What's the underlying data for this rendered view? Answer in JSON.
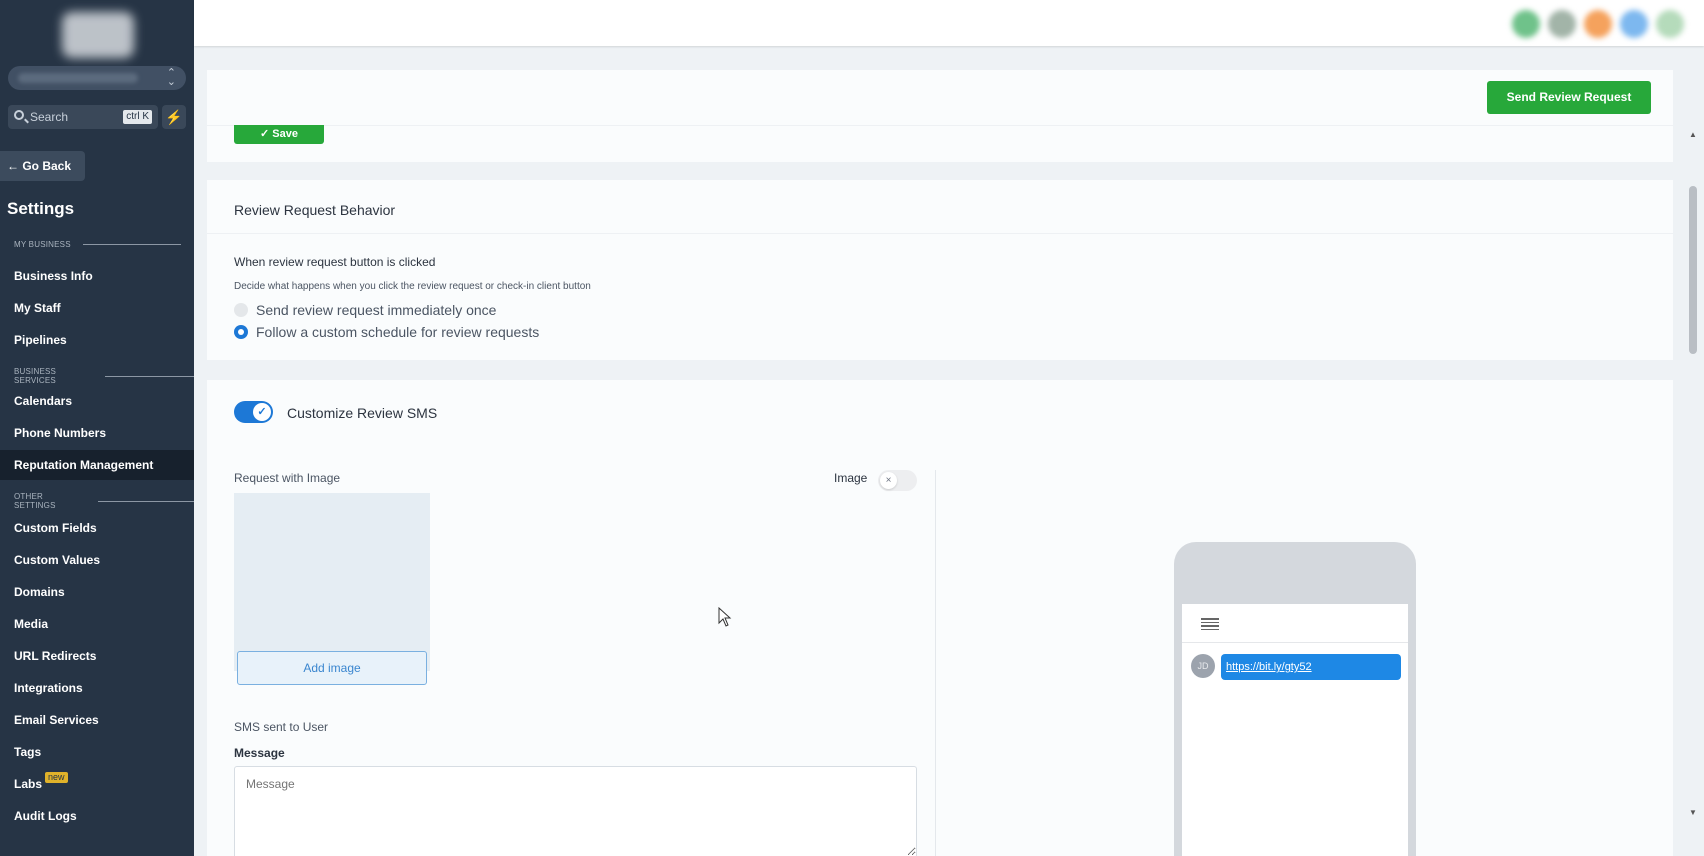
{
  "sidebar": {
    "search_placeholder": "Search",
    "search_shortcut": "ctrl K",
    "go_back": "Go Back",
    "title": "Settings",
    "sections": {
      "my_business": "MY BUSINESS",
      "business_services": "BUSINESS SERVICES",
      "other_settings": "OTHER SETTINGS"
    },
    "items": {
      "business_info": "Business Info",
      "my_staff": "My Staff",
      "pipelines": "Pipelines",
      "calendars": "Calendars",
      "phone_numbers": "Phone Numbers",
      "reputation_management": "Reputation Management",
      "custom_fields": "Custom Fields",
      "custom_values": "Custom Values",
      "domains": "Domains",
      "media": "Media",
      "url_redirects": "URL Redirects",
      "integrations": "Integrations",
      "email_services": "Email Services",
      "tags": "Tags",
      "labs": "Labs",
      "labs_badge": "new",
      "audit_logs": "Audit Logs"
    },
    "active_item": "Reputation Management"
  },
  "toolbar": {
    "save_label": "Save",
    "send_review_request_label": "Send Review Request"
  },
  "behavior": {
    "title": "Review Request Behavior",
    "question": "When review request button is clicked",
    "description": "Decide what happens when you click the review request or check-in client button",
    "options": {
      "immediate": "Send review request immediately once",
      "custom": "Follow a custom schedule for review requests"
    },
    "selected": "Follow a custom schedule for review requests"
  },
  "sms": {
    "toggle_label": "Customize Review SMS",
    "toggle_on": true,
    "request_with_image_label": "Request with Image",
    "image_toggle_label": "Image",
    "image_toggle_on": false,
    "add_image_label": "Add image",
    "sms_sent_label": "SMS sent to User",
    "message_label": "Message",
    "message_placeholder": "Message"
  },
  "preview": {
    "avatar_initials": "JD",
    "link_text": "https://bit.ly/gty52"
  },
  "colors": {
    "sidebar_bg": "#263445",
    "primary_green": "#27a83a",
    "primary_blue": "#1d78d6",
    "bubble_blue": "#1e88e5"
  }
}
